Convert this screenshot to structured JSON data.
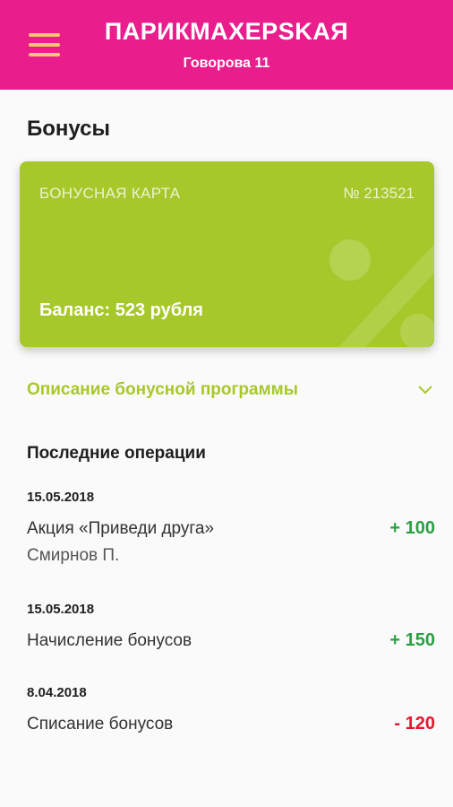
{
  "header": {
    "title": "ПАРИКМАХЕРSKАЯ",
    "address": "Говорова 11"
  },
  "colors": {
    "header_bg": "#e91e8c",
    "card_bg": "#a6c82b",
    "accent_green": "#a6c82b",
    "positive": "#2ba043",
    "negative": "#e8152e"
  },
  "page": {
    "title": "Бонусы"
  },
  "card": {
    "label": "БОНУСНАЯ КАРТА",
    "number": "№ 213521",
    "balance": "Баланс: 523 рубля"
  },
  "program": {
    "label": "Описание бонусной программы",
    "icon": "chevron-down-icon"
  },
  "operations": {
    "title": "Последние операции",
    "items": [
      {
        "date": "15.05.2018",
        "name": "Акция «Приведи друга»",
        "sub": "Смирнов П.",
        "amount": "+ 100",
        "type": "plus"
      },
      {
        "date": "15.05.2018",
        "name": "Начисление бонусов",
        "sub": "",
        "amount": "+ 150",
        "type": "plus"
      },
      {
        "date": "8.04.2018",
        "name": "Списание бонусов",
        "sub": "",
        "amount": "- 120",
        "type": "minus"
      }
    ]
  }
}
